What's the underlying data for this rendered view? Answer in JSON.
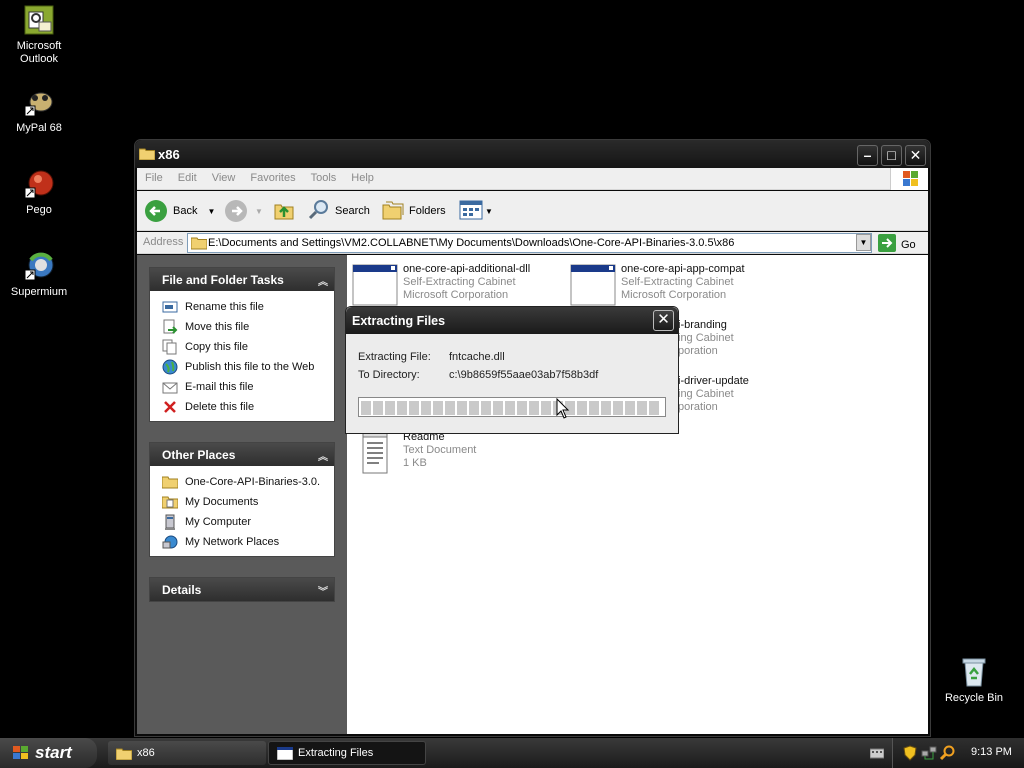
{
  "desktop": {
    "icons": [
      {
        "label": "Microsoft Outlook"
      },
      {
        "label": "MyPal 68"
      },
      {
        "label": "Pego"
      },
      {
        "label": "Supermium"
      },
      {
        "label": "Recycle Bin"
      }
    ]
  },
  "window": {
    "title": "x86",
    "menu": [
      "File",
      "Edit",
      "View",
      "Favorites",
      "Tools",
      "Help"
    ],
    "toolbar": {
      "back": "Back",
      "search": "Search",
      "folders": "Folders"
    },
    "address": {
      "label": "Address",
      "value": "E:\\Documents and Settings\\VM2.COLLABNET\\My Documents\\Downloads\\One-Core-API-Binaries-3.0.5\\x86",
      "go": "Go"
    }
  },
  "tasks_panel": {
    "title": "File and Folder Tasks",
    "items": [
      "Rename this file",
      "Move this file",
      "Copy this file",
      "Publish this file to the Web",
      "E-mail this file",
      "Delete this file"
    ]
  },
  "other_places": {
    "title": "Other Places",
    "items": [
      "One-Core-API-Binaries-3.0.",
      "My Documents",
      "My Computer",
      "My Network Places"
    ]
  },
  "details": {
    "title": "Details"
  },
  "files": [
    {
      "name": "one-core-api-additional-dll",
      "type": "Self-Extracting Cabinet",
      "company": "Microsoft Corporation"
    },
    {
      "name": "one-core-api-app-compat",
      "type": "Self-Extracting Cabinet",
      "company": "Microsoft Corporation"
    },
    {
      "name": "i-branding",
      "type": "ing Cabinet",
      "company": "poration"
    },
    {
      "name": "i-driver-update",
      "type": "ing Cabinet",
      "company": "poration"
    },
    {
      "name": "Readme",
      "type": "Text Document",
      "company": "1 KB"
    }
  ],
  "dialog": {
    "title": "Extracting Files",
    "file_label": "Extracting File:",
    "file_value": "fntcache.dll",
    "dir_label": "To Directory:",
    "dir_value": "c:\\9b8659f55aae03ab7f58b3df",
    "progress_fraction": 0.0
  },
  "taskbar": {
    "start": "start",
    "tasks": [
      {
        "label": "x86"
      },
      {
        "label": "Extracting Files"
      }
    ],
    "clock": "9:13 PM"
  }
}
